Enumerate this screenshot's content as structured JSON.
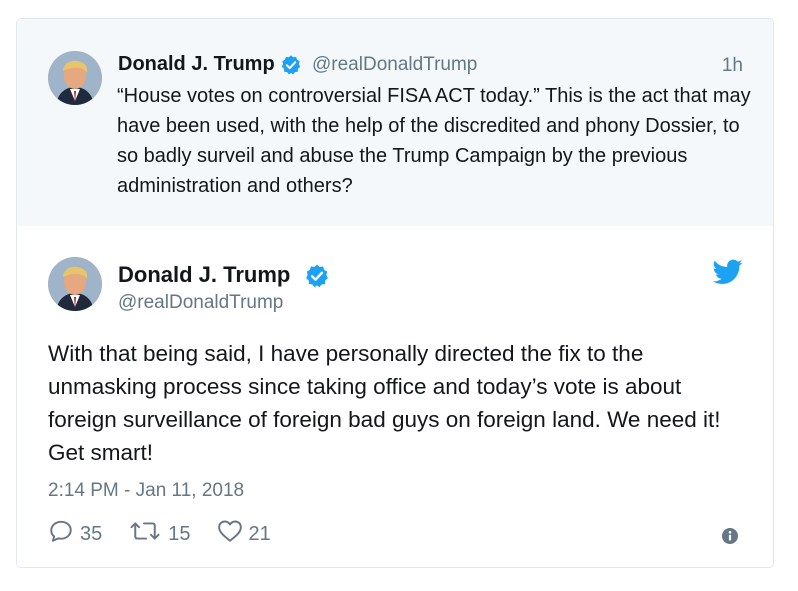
{
  "quoted_tweet": {
    "author_name": "Donald J. Trump",
    "handle": "@realDonaldTrump",
    "time": "1h",
    "text": "“House votes on controversial FISA ACT today.” This is the act that may have been used, with the help of the discredited and phony Dossier, to so badly surveil and abuse the Trump Campaign by the previous administration and others?"
  },
  "main_tweet": {
    "author_name": "Donald J. Trump",
    "handle": "@realDonaldTrump",
    "text": "With that being said, I have personally directed the fix to the unmasking process since taking office and today’s vote is about foreign surveillance of foreign bad guys on foreign land. We need it! Get smart!",
    "timestamp": "2:14 PM - Jan 11, 2018",
    "replies": "35",
    "retweets": "15",
    "likes": "21"
  },
  "icons": {
    "verified": "verified-badge-icon",
    "brand": "twitter-bird-icon",
    "reply": "reply-icon",
    "retweet": "retweet-icon",
    "like": "heart-icon",
    "info": "info-icon"
  },
  "colors": {
    "brand_blue": "#1da1f2",
    "muted_text": "#657786",
    "parent_background": "#f5f8fa",
    "border": "#e1e8ed"
  }
}
